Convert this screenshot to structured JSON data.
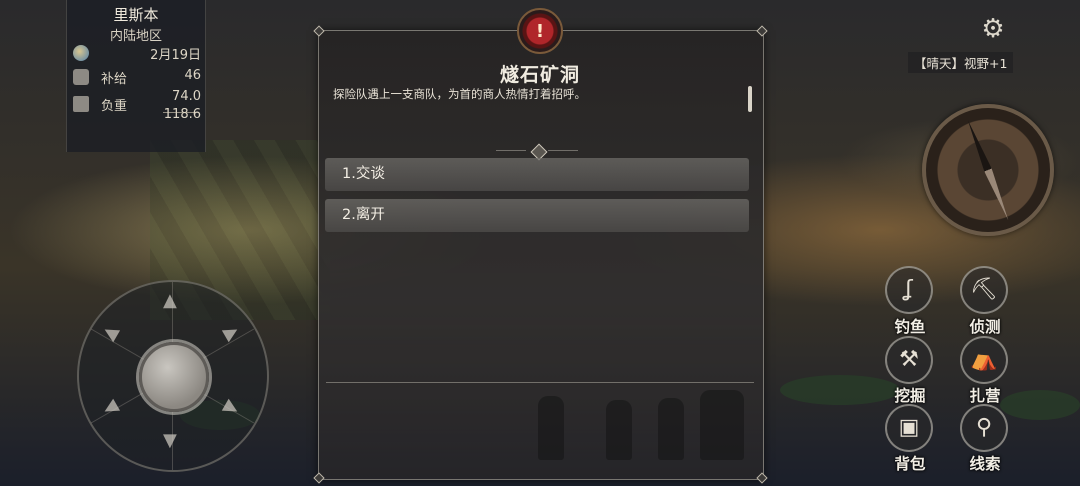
{
  "info_panel": {
    "city": "里斯本",
    "region": "内陆地区",
    "date": "2月19日",
    "supply_label": "补给",
    "supply_value": "46",
    "weight_label": "负重",
    "weight_current": "74.0",
    "weight_max": "118.6"
  },
  "dialog": {
    "badge_symbol": "!",
    "title": "燧石矿洞",
    "description": "探险队遇上一支商队，为首的商人热情打着招呼。",
    "options": [
      {
        "label": "1.交谈"
      },
      {
        "label": "2.离开"
      }
    ]
  },
  "top_right": {
    "weather": "【晴天】视野+1"
  },
  "actions": [
    {
      "label": "钓鱼",
      "icon": "fishing-hook-icon"
    },
    {
      "label": "侦测",
      "icon": "pickaxe-icon"
    },
    {
      "label": "挖掘",
      "icon": "shovel-icon"
    },
    {
      "label": "扎营",
      "icon": "tent-icon"
    },
    {
      "label": "背包",
      "icon": "backpack-icon"
    },
    {
      "label": "线索",
      "icon": "magnifier-icon"
    }
  ],
  "colors": {
    "badge_red": "#b0262a",
    "dialog_bg": "#262424",
    "option_bg": "#6e6c68"
  }
}
